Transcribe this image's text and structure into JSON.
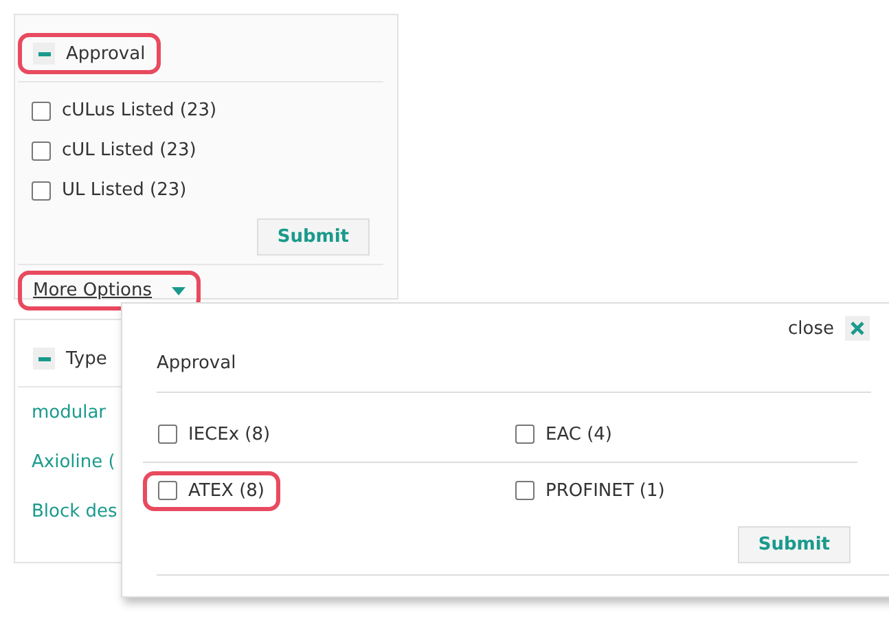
{
  "approval_panel": {
    "title": "Approval",
    "expanded": true,
    "highlighted": true,
    "options": [
      {
        "label": "cULus Listed (23)",
        "checked": false
      },
      {
        "label": "cUL Listed (23)",
        "checked": false
      },
      {
        "label": "UL Listed (23)",
        "checked": false
      }
    ],
    "submit": "Submit",
    "more_options": {
      "label": "More Options",
      "highlighted": true
    }
  },
  "type_panel": {
    "title": "Type",
    "expanded": true,
    "links": [
      "modular",
      "Axioline (",
      "Block des"
    ]
  },
  "popup": {
    "close": "close",
    "heading": "Approval",
    "options": [
      {
        "label": "IECEx (8)",
        "checked": false,
        "highlighted": false
      },
      {
        "label": "EAC (4)",
        "checked": false,
        "highlighted": false
      },
      {
        "label": "ATEX (8)",
        "checked": false,
        "highlighted": true
      },
      {
        "label": "PROFINET (1)",
        "checked": false,
        "highlighted": false
      }
    ],
    "submit": "Submit"
  }
}
